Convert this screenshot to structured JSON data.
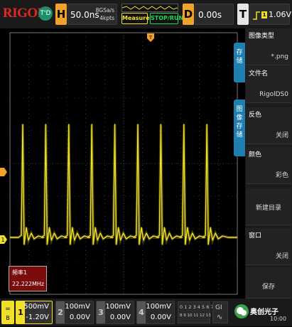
{
  "brand": "RIGOL",
  "mode_badge": "T'D",
  "horizontal": {
    "key": "H",
    "timebase": "50.0ns",
    "sample_rate": "8GSa/s",
    "memory_depth": "4kpts"
  },
  "buttons": {
    "measure": "Measure",
    "stop_run": "STOP/RUN"
  },
  "delay": {
    "key": "D",
    "value": "0.00s"
  },
  "trigger": {
    "key": "T",
    "level": "1.06V",
    "icon": "trigger-edge-icon"
  },
  "menu": {
    "tab_save": "存\n储",
    "tab_image_save": "图\n像\n存\n储",
    "items": [
      {
        "title": "图像类型",
        "value": "*.png"
      },
      {
        "title": "文件名",
        "value": "RigolDS0"
      },
      {
        "title": "反色",
        "value": "关闭"
      },
      {
        "title": "颜色",
        "value": "彩色"
      },
      {
        "title": "",
        "value": "新建目录"
      },
      {
        "title": "窗口",
        "value": "关闭"
      },
      {
        "title": "",
        "value": "保存"
      }
    ]
  },
  "frequency_box": {
    "title": "频率1",
    "value": "22.222MHz"
  },
  "channels": [
    {
      "num": "1",
      "scale": "500mV",
      "offset": "-1.20V",
      "active": true
    },
    {
      "num": "2",
      "scale": "100mV",
      "offset": "0.00V",
      "active": false
    },
    {
      "num": "3",
      "scale": "100mV",
      "offset": "0.00V",
      "active": false
    },
    {
      "num": "4",
      "scale": "100mV",
      "offset": "0.00V",
      "active": false
    }
  ],
  "digital": {
    "row1": "0 1 2 3 4 5 6 7",
    "row2": "8 9 10 11 12 13 14 15"
  },
  "gi": "GI",
  "clock": "10:00",
  "watermark": "奥创光子",
  "colors": {
    "ch1": "#f1e02a",
    "accent_orange": "#f1a22a",
    "menu_tab": "#1e7fb0",
    "freq_box": "#7a0c0c"
  },
  "waveform": {
    "pulse_count": 9,
    "pulse_period_div": 0.9
  }
}
